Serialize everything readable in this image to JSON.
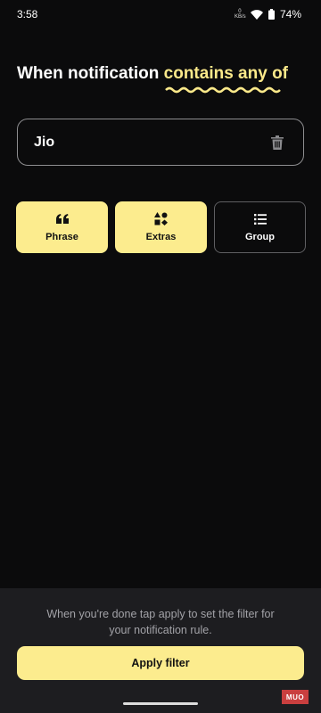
{
  "status_bar": {
    "time": "3:58",
    "data_speed": "0",
    "data_unit": "KB/s",
    "battery": "74%"
  },
  "header": {
    "title_prefix": "When notification",
    "title_accent": "contains any of",
    "accent_color": "#fbe98a"
  },
  "filter": {
    "value": "Jio"
  },
  "options": [
    {
      "label": "Phrase",
      "icon": "quote-icon",
      "selected": true
    },
    {
      "label": "Extras",
      "icon": "shapes-icon",
      "selected": true
    },
    {
      "label": "Group",
      "icon": "list-icon",
      "selected": false
    }
  ],
  "footer": {
    "hint": "When you're done tap apply to set the filter for your notification rule.",
    "apply_label": "Apply filter"
  },
  "watermark": "MUO"
}
